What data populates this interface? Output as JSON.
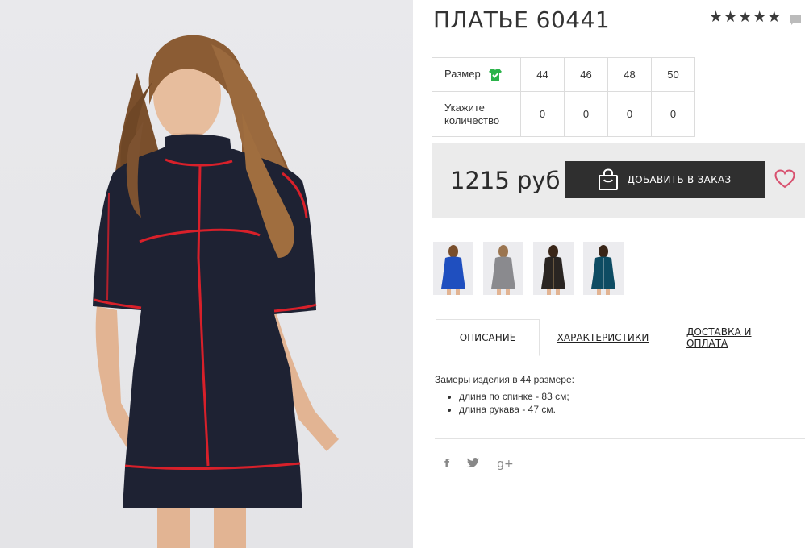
{
  "product": {
    "title": "ПЛАТЬЕ 60441",
    "rating_stars": 5,
    "price": "1215 руб"
  },
  "size_table": {
    "size_label": "Размер",
    "sizes": [
      "44",
      "46",
      "48",
      "50"
    ],
    "qty_label_line1": "Укажите",
    "qty_label_line2": "количество",
    "quantities": [
      "0",
      "0",
      "0",
      "0"
    ]
  },
  "actions": {
    "add_to_order": "ДОБАВИТЬ В ЗАКАЗ"
  },
  "thumbnails": [
    {
      "color": "#1f4fbf"
    },
    {
      "color": "#8a8a8e"
    },
    {
      "color": "#2a2522"
    },
    {
      "color": "#0e4c63"
    }
  ],
  "tabs": [
    {
      "label": "ОПИСАНИЕ"
    },
    {
      "label": "ХАРАКТЕРИСТИКИ"
    },
    {
      "label": "ДОСТАВКА И ОПЛАТА"
    }
  ],
  "description": {
    "intro": "Замеры изделия в 44 размере:",
    "items": [
      "длина по спинке - 83 см;",
      "длина рукава - 47 см."
    ]
  },
  "social": {
    "facebook": "f",
    "twitter": "t",
    "googleplus": "g+"
  },
  "colors": {
    "dress": "#1e2233",
    "piping": "#d8202a",
    "button": "#2f2f2f",
    "heart": "#d8506e",
    "size_icon": "#2bb34a"
  }
}
